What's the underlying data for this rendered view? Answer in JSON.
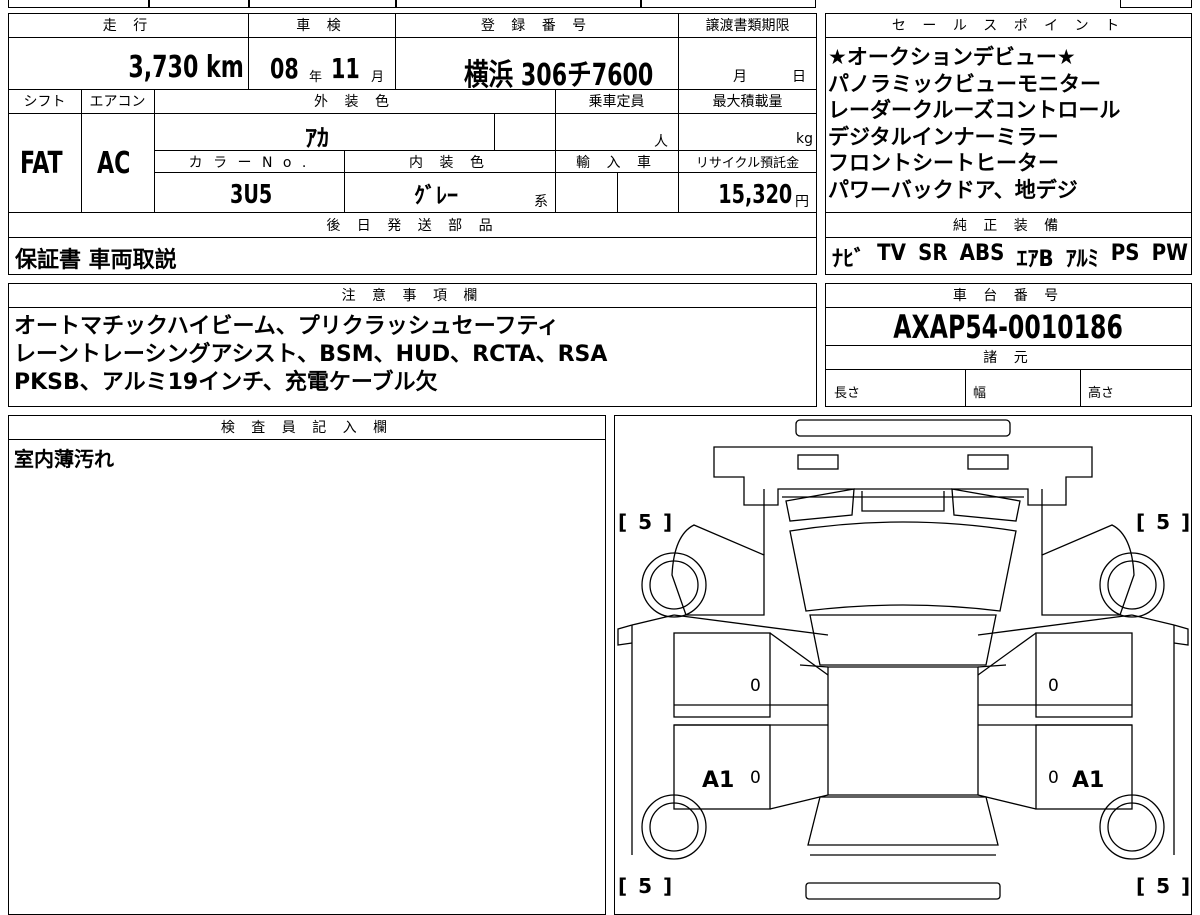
{
  "vehicle": {
    "headers": {
      "mileage": "走 行",
      "inspection": "車 検",
      "registration": "登 録 番 号",
      "transfer_deadline": "譲渡書類期限",
      "shift": "シフト",
      "aircon": "エアコン",
      "exterior_color": "外 装 色",
      "capacity": "乗車定員",
      "max_load": "最大積載量",
      "color_no": "カ ラ ー N o .",
      "interior_color": "内 装 色",
      "import": "輸 入 車",
      "recycle": "リサイクル預託金",
      "later_parts": "後 日 発 送 部 品"
    },
    "mileage": "3,730 km",
    "inspection_year": "08",
    "inspection_year_unit": "年",
    "inspection_month": "11",
    "inspection_month_unit": "月",
    "registration": "横浜 306チ7600",
    "deadline_month_unit": "月",
    "deadline_day_unit": "日",
    "shift": "FAT",
    "aircon": "AC",
    "exterior_color": "ｱｶ",
    "capacity_unit": "人",
    "max_load_unit": "kg",
    "color_no": "3U5",
    "interior_color": "ｸﾞﾚｰ",
    "interior_suffix": "系",
    "recycle_amount": "15,320",
    "recycle_unit": "円",
    "later_parts": "保証書 車両取説"
  },
  "sales_points": {
    "header": "セ ー ル ス ポ イ ン ト",
    "lines": [
      "★オークションデビュー★",
      "パノラミックビューモニター",
      "レーダークルーズコントロール",
      "デジタルインナーミラー",
      "フロントシートヒーター",
      "パワーバックドア、地デジ"
    ]
  },
  "equipment": {
    "header": "純 正 装 備",
    "items": [
      "ﾅﾋﾞ",
      "TV",
      "SR",
      "ABS",
      "ｴｱB",
      "ｱﾙﾐ",
      "PS",
      "PW"
    ]
  },
  "notes": {
    "header": "注 意 事 項 欄",
    "lines": [
      "オートマチックハイビーム、プリクラッシュセーフティ",
      "レーントレーシングアシスト、BSM、HUD、RCTA、RSA",
      "PKSB、アルミ19インチ、充電ケーブル欠"
    ]
  },
  "chassis": {
    "header": "車 台 番 号",
    "number": "AXAP54-0010186",
    "spec_header": "諸 元",
    "length": "長さ",
    "width": "幅",
    "height": "高さ"
  },
  "inspector": {
    "header": "検 査 員 記 入 欄",
    "remark": "室内薄汚れ"
  },
  "diagram": {
    "tire_marks": [
      "[ 5 ]",
      "[ 5 ]",
      "[ 5 ]",
      "[ 5 ]"
    ],
    "damage_left": "A1",
    "damage_right": "A1",
    "zeros": [
      "0",
      "0",
      "0",
      "0"
    ]
  }
}
